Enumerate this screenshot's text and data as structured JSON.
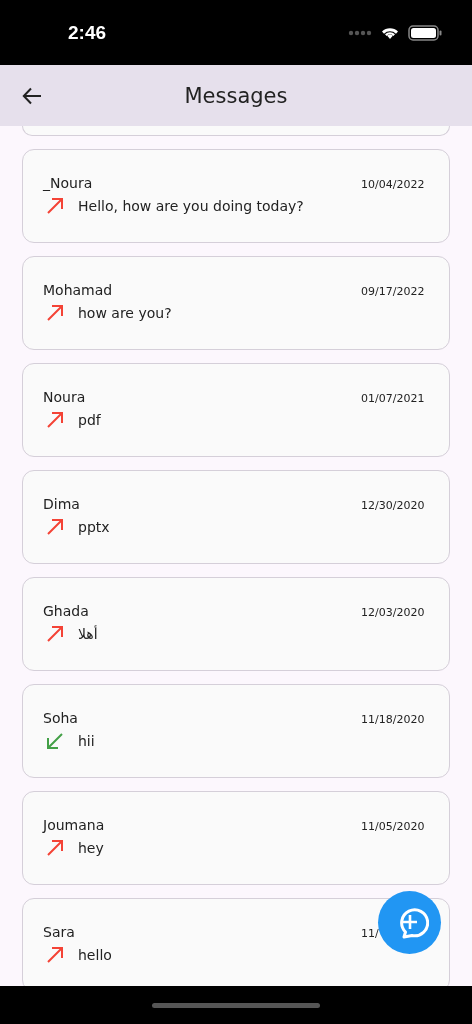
{
  "status_bar": {
    "time": "2:46"
  },
  "header": {
    "title": "Messages"
  },
  "conversations": [
    {
      "name": "_Noura",
      "date": "10/04/2022",
      "message": "Hello, how are you doing today?",
      "kind": "outgoing"
    },
    {
      "name": "Mohamad",
      "date": "09/17/2022",
      "message": "how are you?",
      "kind": "outgoing"
    },
    {
      "name": "Noura",
      "date": "01/07/2021",
      "message": "pdf",
      "kind": "outgoing"
    },
    {
      "name": "Dima",
      "date": "12/30/2020",
      "message": "pptx",
      "kind": "outgoing"
    },
    {
      "name": "Ghada",
      "date": "12/03/2020",
      "message": "أهلا",
      "kind": "outgoing"
    },
    {
      "name": "Soha",
      "date": "11/18/2020",
      "message": "hii",
      "kind": "incoming"
    },
    {
      "name": "Joumana",
      "date": "11/05/2020",
      "message": "hey",
      "kind": "outgoing"
    },
    {
      "name": "Sara",
      "date": "11/",
      "message": "hello",
      "kind": "outgoing"
    }
  ]
}
